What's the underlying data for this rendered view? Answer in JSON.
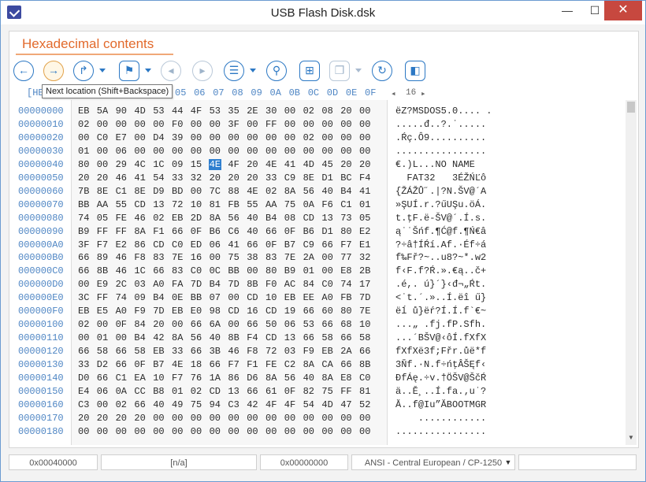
{
  "window": {
    "title": "USB Flash Disk.dsk",
    "min": "—",
    "max": "☐",
    "close": "✕"
  },
  "tab": {
    "title": "Hexadecimal contents"
  },
  "toolbar": {
    "tooltip": "Next location (Shift+Backspace)",
    "buttons": [
      {
        "name": "back-button",
        "glyph": "←"
      },
      {
        "name": "next-location-button",
        "glyph": "→"
      },
      {
        "name": "goto-button",
        "glyph": "↱"
      },
      {
        "name": "bookmark-button",
        "glyph": "⚑"
      },
      {
        "name": "prev-bookmark-button",
        "glyph": "◂"
      },
      {
        "name": "next-bookmark-button",
        "glyph": "▸"
      },
      {
        "name": "list-button",
        "glyph": "☰"
      },
      {
        "name": "search-button",
        "glyph": "⚲"
      },
      {
        "name": "grid-button",
        "glyph": "⊞"
      },
      {
        "name": "copy-button",
        "glyph": "❐"
      },
      {
        "name": "refresh-button",
        "glyph": "↻"
      },
      {
        "name": "panel-button",
        "glyph": "◧"
      }
    ]
  },
  "hex_header": {
    "prefix": "[HE",
    "columns": [
      "05",
      "06",
      "07",
      "08",
      "09",
      "0A",
      "0B",
      "0C",
      "0D",
      "0E",
      "0F"
    ],
    "scale_label": "16",
    "scale_left": "◂",
    "scale_right": "▸"
  },
  "rows": [
    {
      "offset": "00000000",
      "bytes": [
        "EB",
        "5A",
        "90",
        "4D",
        "53",
        "44",
        "4F",
        "53",
        "35",
        "2E",
        "30",
        "00",
        "02",
        "08",
        "20",
        "00"
      ],
      "text": "ëZ?MSDOS5.0.... ."
    },
    {
      "offset": "00000010",
      "bytes": [
        "02",
        "00",
        "00",
        "00",
        "00",
        "F0",
        "00",
        "00",
        "3F",
        "00",
        "FF",
        "00",
        "00",
        "00",
        "00",
        "00"
      ],
      "text": ".....đ..?.˙....."
    },
    {
      "offset": "00000020",
      "bytes": [
        "00",
        "C0",
        "E7",
        "00",
        "D4",
        "39",
        "00",
        "00",
        "00",
        "00",
        "00",
        "00",
        "02",
        "00",
        "00",
        "00"
      ],
      "text": ".Ŕç.Ô9.........."
    },
    {
      "offset": "00000030",
      "bytes": [
        "01",
        "00",
        "06",
        "00",
        "00",
        "00",
        "00",
        "00",
        "00",
        "00",
        "00",
        "00",
        "00",
        "00",
        "00",
        "00"
      ],
      "text": "................"
    },
    {
      "offset": "00000040",
      "bytes": [
        "80",
        "00",
        "29",
        "4C",
        "1C",
        "09",
        "15",
        "4E",
        "4F",
        "20",
        "4E",
        "41",
        "4D",
        "45",
        "20",
        "20"
      ],
      "text": "€.)L...NO NAME  "
    },
    {
      "offset": "00000050",
      "bytes": [
        "20",
        "20",
        "46",
        "41",
        "54",
        "33",
        "32",
        "20",
        "20",
        "20",
        "33",
        "C9",
        "8E",
        "D1",
        "BC",
        "F4"
      ],
      "text": "  FAT32   3ÉŽŃĽô"
    },
    {
      "offset": "00000060",
      "bytes": [
        "7B",
        "8E",
        "C1",
        "8E",
        "D9",
        "BD",
        "00",
        "7C",
        "88",
        "4E",
        "02",
        "8A",
        "56",
        "40",
        "B4",
        "41"
      ],
      "text": "{ŽÁŽŮ˝.|?N.ŠV@´A"
    },
    {
      "offset": "00000070",
      "bytes": [
        "BB",
        "AA",
        "55",
        "CD",
        "13",
        "72",
        "10",
        "81",
        "FB",
        "55",
        "AA",
        "75",
        "0A",
        "F6",
        "C1",
        "01"
      ],
      "text": "»ŞUÍ.r.?űUŞu.öÁ."
    },
    {
      "offset": "00000080",
      "bytes": [
        "74",
        "05",
        "FE",
        "46",
        "02",
        "EB",
        "2D",
        "8A",
        "56",
        "40",
        "B4",
        "08",
        "CD",
        "13",
        "73",
        "05"
      ],
      "text": "t.ţF.ë-ŠV@´.Í.s."
    },
    {
      "offset": "00000090",
      "bytes": [
        "B9",
        "FF",
        "FF",
        "8A",
        "F1",
        "66",
        "0F",
        "B6",
        "C6",
        "40",
        "66",
        "0F",
        "B6",
        "D1",
        "80",
        "E2"
      ],
      "text": "ą˙˙Šńf.¶Ć@f.¶Ń€â"
    },
    {
      "offset": "000000A0",
      "bytes": [
        "3F",
        "F7",
        "E2",
        "86",
        "CD",
        "C0",
        "ED",
        "06",
        "41",
        "66",
        "0F",
        "B7",
        "C9",
        "66",
        "F7",
        "E1"
      ],
      "text": "?÷â†ÍŔí.Af.·Éf÷á"
    },
    {
      "offset": "000000B0",
      "bytes": [
        "66",
        "89",
        "46",
        "F8",
        "83",
        "7E",
        "16",
        "00",
        "75",
        "38",
        "83",
        "7E",
        "2A",
        "00",
        "77",
        "32"
      ],
      "text": "f‰Fř?~..u8?~*.w2"
    },
    {
      "offset": "000000C0",
      "bytes": [
        "66",
        "8B",
        "46",
        "1C",
        "66",
        "83",
        "C0",
        "0C",
        "BB",
        "00",
        "80",
        "B9",
        "01",
        "00",
        "E8",
        "2B"
      ],
      "text": "f‹F.f?Ŕ.».€ą..č+"
    },
    {
      "offset": "000000D0",
      "bytes": [
        "00",
        "E9",
        "2C",
        "03",
        "A0",
        "FA",
        "7D",
        "B4",
        "7D",
        "8B",
        "F0",
        "AC",
        "84",
        "C0",
        "74",
        "17"
      ],
      "text": ".é,. ú}´}‹đ¬„Ŕt."
    },
    {
      "offset": "000000E0",
      "bytes": [
        "3C",
        "FF",
        "74",
        "09",
        "B4",
        "0E",
        "BB",
        "07",
        "00",
        "CD",
        "10",
        "EB",
        "EE",
        "A0",
        "FB",
        "7D"
      ],
      "text": "<˙t.´.»..Í.ëî ű}"
    },
    {
      "offset": "000000F0",
      "bytes": [
        "EB",
        "E5",
        "A0",
        "F9",
        "7D",
        "EB",
        "E0",
        "98",
        "CD",
        "16",
        "CD",
        "19",
        "66",
        "60",
        "80",
        "7E"
      ],
      "text": "ëĺ ů}ëŕ?Í.Í.f`€~"
    },
    {
      "offset": "00000100",
      "bytes": [
        "02",
        "00",
        "0F",
        "84",
        "20",
        "00",
        "66",
        "6A",
        "00",
        "66",
        "50",
        "06",
        "53",
        "66",
        "68",
        "10"
      ],
      "text": "...„ .fj.fP.Sfh."
    },
    {
      "offset": "00000110",
      "bytes": [
        "00",
        "01",
        "00",
        "B4",
        "42",
        "8A",
        "56",
        "40",
        "8B",
        "F4",
        "CD",
        "13",
        "66",
        "58",
        "66",
        "58"
      ],
      "text": "...´BŠV@‹ôÍ.fXfX"
    },
    {
      "offset": "00000120",
      "bytes": [
        "66",
        "58",
        "66",
        "58",
        "EB",
        "33",
        "66",
        "3B",
        "46",
        "F8",
        "72",
        "03",
        "F9",
        "EB",
        "2A",
        "66"
      ],
      "text": "fXfXë3f;Fřr.ůë*f"
    },
    {
      "offset": "00000130",
      "bytes": [
        "33",
        "D2",
        "66",
        "0F",
        "B7",
        "4E",
        "18",
        "66",
        "F7",
        "F1",
        "FE",
        "C2",
        "8A",
        "CA",
        "66",
        "8B"
      ],
      "text": "3Ňf.·N.f÷ńţÂŠĘf‹"
    },
    {
      "offset": "00000140",
      "bytes": [
        "D0",
        "66",
        "C1",
        "EA",
        "10",
        "F7",
        "76",
        "1A",
        "86",
        "D6",
        "8A",
        "56",
        "40",
        "8A",
        "E8",
        "C0"
      ],
      "text": "ĐfÁę.÷v.†ÖŠV@ŠčŔ"
    },
    {
      "offset": "00000150",
      "bytes": [
        "E4",
        "06",
        "0A",
        "CC",
        "B8",
        "01",
        "02",
        "CD",
        "13",
        "66",
        "61",
        "0F",
        "82",
        "75",
        "FF",
        "81"
      ],
      "text": "ä..Ě¸..Í.fa.‚u˙?"
    },
    {
      "offset": "00000160",
      "bytes": [
        "C3",
        "00",
        "02",
        "66",
        "40",
        "49",
        "75",
        "94",
        "C3",
        "42",
        "4F",
        "4F",
        "54",
        "4D",
        "47",
        "52"
      ],
      "text": "Ă..f@Iu”ĂBOOTMGR"
    },
    {
      "offset": "00000170",
      "bytes": [
        "20",
        "20",
        "20",
        "20",
        "00",
        "00",
        "00",
        "00",
        "00",
        "00",
        "00",
        "00",
        "00",
        "00",
        "00",
        "00"
      ],
      "text": "    ............"
    },
    {
      "offset": "00000180",
      "bytes": [
        "00",
        "00",
        "00",
        "00",
        "00",
        "00",
        "00",
        "00",
        "00",
        "00",
        "00",
        "00",
        "00",
        "00",
        "00",
        "00"
      ],
      "text": "................"
    }
  ],
  "selection": {
    "row": 4,
    "col": 7
  },
  "status": {
    "offset": "0x00040000",
    "value": "[n/a]",
    "address": "0x00000000",
    "encoding": "ANSI - Central European / CP-1250",
    "extra": ""
  },
  "colors": {
    "accent": "#2c78c4",
    "tab_title": "#e26a2c",
    "selection": "#2f7fcf",
    "close": "#c7483f"
  }
}
